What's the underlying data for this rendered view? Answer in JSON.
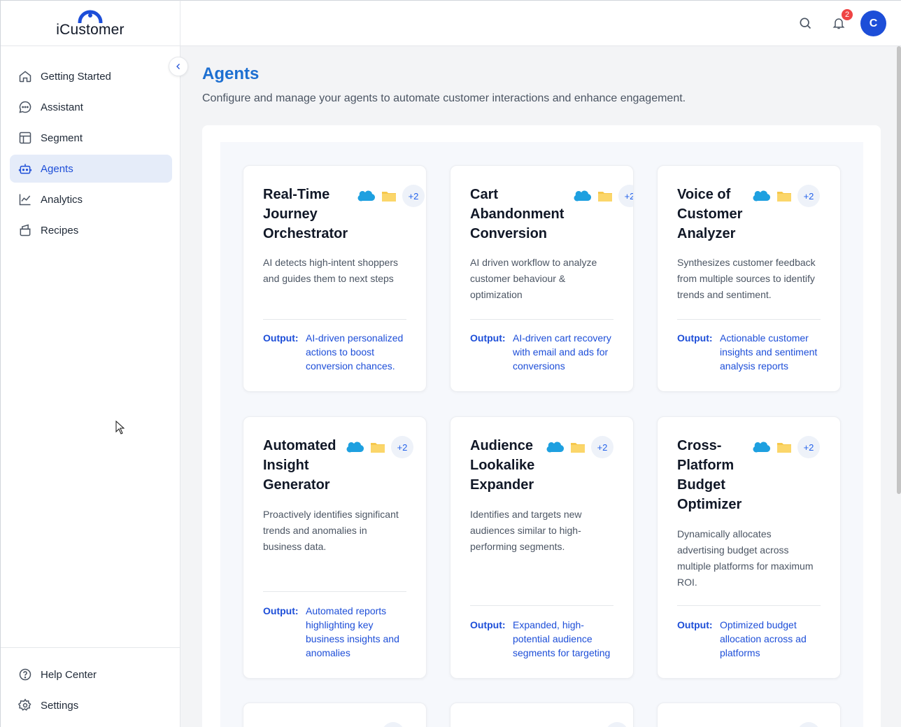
{
  "brand": {
    "name": "iCustomer"
  },
  "sidebar": {
    "items": [
      {
        "label": "Getting Started",
        "icon": "home-icon"
      },
      {
        "label": "Assistant",
        "icon": "chat-icon"
      },
      {
        "label": "Segment",
        "icon": "layout-icon"
      },
      {
        "label": "Agents",
        "icon": "robot-icon",
        "active": true
      },
      {
        "label": "Analytics",
        "icon": "chart-line-icon"
      },
      {
        "label": "Recipes",
        "icon": "recipes-icon"
      }
    ],
    "bottom": [
      {
        "label": "Help Center",
        "icon": "help-icon"
      },
      {
        "label": "Settings",
        "icon": "gear-icon"
      }
    ]
  },
  "header": {
    "notifications_count": "2",
    "avatar_initial": "C"
  },
  "main": {
    "title": "Agents",
    "subtitle": "Configure and manage your agents to automate customer interactions and enhance engagement.",
    "output_label": "Output:",
    "cards": [
      {
        "title": "Real-Time Journey Orchestrator",
        "badge_count": "+2",
        "description": "AI detects high-intent shoppers and guides them to next steps",
        "output": "AI-driven personalized actions to boost conversion chances."
      },
      {
        "title": "Cart Abandonment Conversion",
        "badge_count": "+2",
        "description": "AI driven workflow to analyze customer behaviour & optimization",
        "output": "AI-driven cart recovery with email and ads for conversions"
      },
      {
        "title": "Voice of Customer Analyzer",
        "badge_count": "+2",
        "description": "Synthesizes customer feedback from multiple sources to identify trends and sentiment.",
        "output": "Actionable customer insights and sentiment analysis reports"
      },
      {
        "title": "Automated Insight Generator",
        "badge_count": "+2",
        "description": "Proactively identifies significant trends and anomalies in business data.",
        "output": "Automated reports highlighting key business insights and anomalies"
      },
      {
        "title": "Audience Lookalike Expander",
        "badge_count": "+2",
        "description": "Identifies and targets new audiences similar to high-performing segments.",
        "output": "Expanded, high-potential audience segments for targeting"
      },
      {
        "title": "Cross-Platform Budget Optimizer",
        "badge_count": "+2",
        "description": "Dynamically allocates advertising budget across multiple platforms for maximum ROI.",
        "output": "Optimized budget allocation across ad platforms"
      }
    ]
  },
  "colors": {
    "accent": "#1d6fd1",
    "active_bg": "#e5ecf9",
    "badge": "#ef4444",
    "avatar": "#1d4ed8"
  }
}
